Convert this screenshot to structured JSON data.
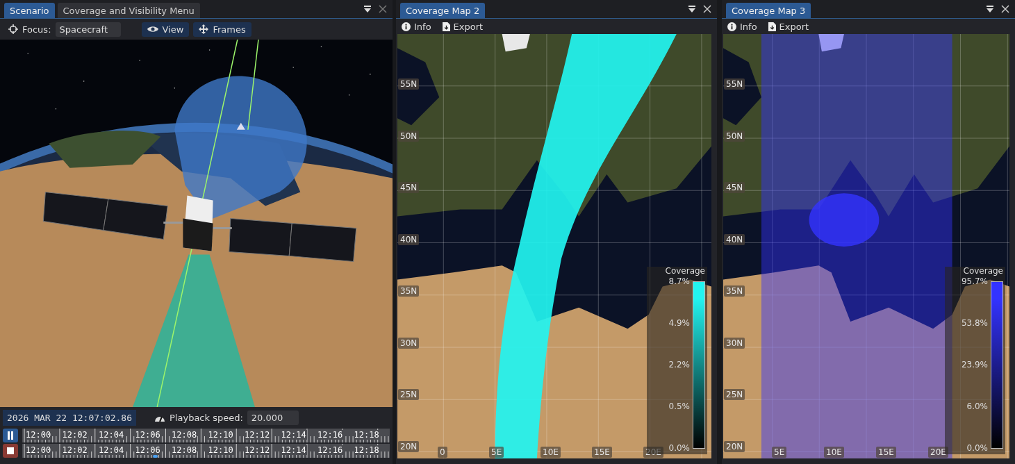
{
  "scenario_panel": {
    "tabs": [
      {
        "label": "Scenario",
        "selected": true
      },
      {
        "label": "Coverage and Visibility Menu",
        "selected": false
      }
    ],
    "toolbar": {
      "focus_label": "Focus:",
      "focus_value": "Spacecraft",
      "buttons": [
        {
          "label": "View",
          "kind": "view"
        },
        {
          "label": "Frames",
          "kind": "frames"
        }
      ]
    },
    "status": {
      "datetime": "2026 MAR 22 12:07:02.86",
      "speed_label": "Playback speed:",
      "speed_value": "20.000"
    },
    "timeline": {
      "rows": [
        {
          "kind": "pause",
          "labels": [
            "12:00",
            "12:02",
            "12:04",
            "12:06",
            "12:08",
            "12:10",
            "12:12",
            "12:14",
            "12:16",
            "12:18"
          ]
        },
        {
          "kind": "stop",
          "labels": [
            "12:00",
            "12:02",
            "12:04",
            "12:06",
            "12:08",
            "12:10",
            "12:12",
            "12:14",
            "12:16",
            "12:18"
          ],
          "level": 0.355
        }
      ]
    }
  },
  "maps": [
    {
      "tab": {
        "label": "Coverage Map 2",
        "selected": true
      },
      "tools": [
        {
          "label": "Info",
          "kind": "info"
        },
        {
          "label": "Export",
          "kind": "export"
        }
      ],
      "kind": "swath",
      "lat_labels": [
        "55N",
        "50N",
        "45N",
        "40N",
        "35N",
        "30N",
        "25N",
        "20N"
      ],
      "lon_labels": [
        "0",
        "5E",
        "10E",
        "15E",
        "20E"
      ],
      "legend": {
        "title": "Coverage",
        "color": "#22f4f0",
        "ticks": [
          "8.7%",
          "4.9%",
          "2.2%",
          "0.5%",
          "0.0%"
        ]
      }
    },
    {
      "tab": {
        "label": "Coverage Map 3",
        "selected": true
      },
      "tools": [
        {
          "label": "Info",
          "kind": "info"
        },
        {
          "label": "Export",
          "kind": "export"
        }
      ],
      "kind": "area",
      "lat_labels": [
        "55N",
        "50N",
        "45N",
        "40N",
        "35N",
        "30N",
        "25N",
        "20N"
      ],
      "lon_labels": [
        "5E",
        "10E",
        "15E",
        "20E"
      ],
      "legend": {
        "title": "Coverage",
        "color": "#3333ff",
        "ticks": [
          "95.7%",
          "53.8%",
          "23.9%",
          "6.0%",
          "0.0%"
        ]
      }
    }
  ]
}
